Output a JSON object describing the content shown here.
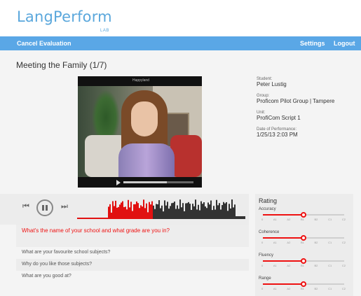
{
  "brand": {
    "logo": "LangPerform",
    "sub": "LAB",
    "color": "#5aa7dc"
  },
  "nav": {
    "cancel": "Cancel Evaluation",
    "settings": "Settings",
    "logout": "Logout",
    "bar_color": "#5aa7e6"
  },
  "page": {
    "title": "Meeting the Family (1/7)"
  },
  "video": {
    "top_label": "Happyland",
    "progress_fraction": 0.62
  },
  "student": {
    "fields": [
      {
        "label": "Student:",
        "value": "Peter Lustig"
      },
      {
        "label": "Group:",
        "value": "Proficom Pilot Group | Tampere"
      },
      {
        "label": "Unit:",
        "value": "ProfiCom Script 1"
      },
      {
        "label": "Date of Performance:",
        "value": "1/25/13 2:03 PM"
      }
    ]
  },
  "player": {
    "played_fraction": 0.45,
    "played_color": "#e11111",
    "unplayed_color": "#333333"
  },
  "questions": {
    "current": "What's the name of your school and what grade are you in?",
    "list": [
      "What are your favourite school subjects?",
      "Why do you like those subjects?",
      "What are you good at?"
    ]
  },
  "rating": {
    "title": "Rating",
    "scale": [
      "0",
      "A1",
      "A2",
      "B1",
      "B2",
      "C1",
      "C2"
    ],
    "categories": [
      {
        "name": "Accuracy",
        "level": 3
      },
      {
        "name": "Coherence",
        "level": 3
      },
      {
        "name": "Fluency",
        "level": 3
      },
      {
        "name": "Range",
        "level": 3
      }
    ]
  }
}
